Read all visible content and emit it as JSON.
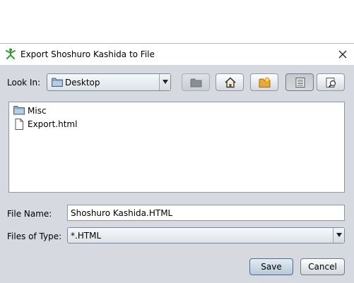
{
  "window": {
    "title": "Export Shoshuro Kashida to File"
  },
  "look_in": {
    "label": "Look In:",
    "selected": "Desktop"
  },
  "toolbar": {
    "up_icon": "up-one-level-icon",
    "home_icon": "home-icon",
    "new_folder_icon": "new-folder-icon",
    "list_icon": "list-view-icon",
    "details_icon": "details-view-icon"
  },
  "files": [
    {
      "name": "Misc",
      "icon": "folder-icon"
    },
    {
      "name": "Export.html",
      "icon": "document-icon"
    }
  ],
  "file_name": {
    "label": "File Name:",
    "value": "Shoshuro Kashida.HTML"
  },
  "file_type": {
    "label": "Files of Type:",
    "selected": "*.HTML"
  },
  "buttons": {
    "save": "Save",
    "cancel": "Cancel"
  },
  "colors": {
    "dialog_bg": "#d6d9df",
    "icon_green": "#2e9a2e",
    "folder_blue": "#7d9bbd"
  }
}
